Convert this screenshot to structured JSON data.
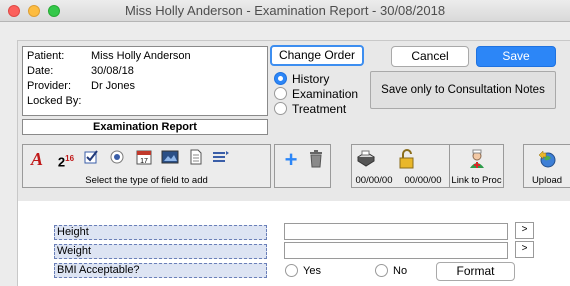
{
  "window": {
    "title": "Miss Holly Anderson - Examination Report - 30/08/2018"
  },
  "patient": {
    "rows": [
      {
        "label": "Patient:",
        "value": "Miss Holly Anderson"
      },
      {
        "label": "Date:",
        "value": "30/08/18"
      },
      {
        "label": "Provider:",
        "value": "Dr Jones"
      },
      {
        "label": "Locked By:",
        "value": ""
      }
    ]
  },
  "report_title": "Examination Report",
  "buttons": {
    "change_order": "Change Order",
    "cancel": "Cancel",
    "save": "Save",
    "save_notes": "Save only to Consultation Notes",
    "format": "Format",
    "arrow": ">"
  },
  "view_options": {
    "selected": "History",
    "items": [
      "History",
      "Examination",
      "Treatment"
    ]
  },
  "toolbar": {
    "fields_caption": "Select the type of field to add",
    "superscript_label": "2",
    "superscript_sup": "16",
    "calendar_day": "17",
    "date1": "00/00/00",
    "date2": "00/00/00",
    "link_caption": "Link to Proc",
    "upload_caption": "Upload",
    "icons": [
      "text-a-icon",
      "number-icon",
      "checkbox-icon",
      "radio-icon",
      "calendar-icon",
      "image-icon",
      "document-icon",
      "list-icon",
      "add-icon",
      "trash-icon",
      "printer-icon",
      "lock-icon",
      "nurse-icon",
      "upload-icon"
    ]
  },
  "form": {
    "height_label": "Height",
    "height_value": "",
    "weight_label": "Weight",
    "weight_value": "",
    "bmi_label": "BMI Acceptable?",
    "bmi_options": [
      "Yes",
      "No"
    ],
    "bmi_selected": ""
  },
  "colors": {
    "accent": "#2c86f7",
    "field_label_bg": "#dde4f3"
  }
}
